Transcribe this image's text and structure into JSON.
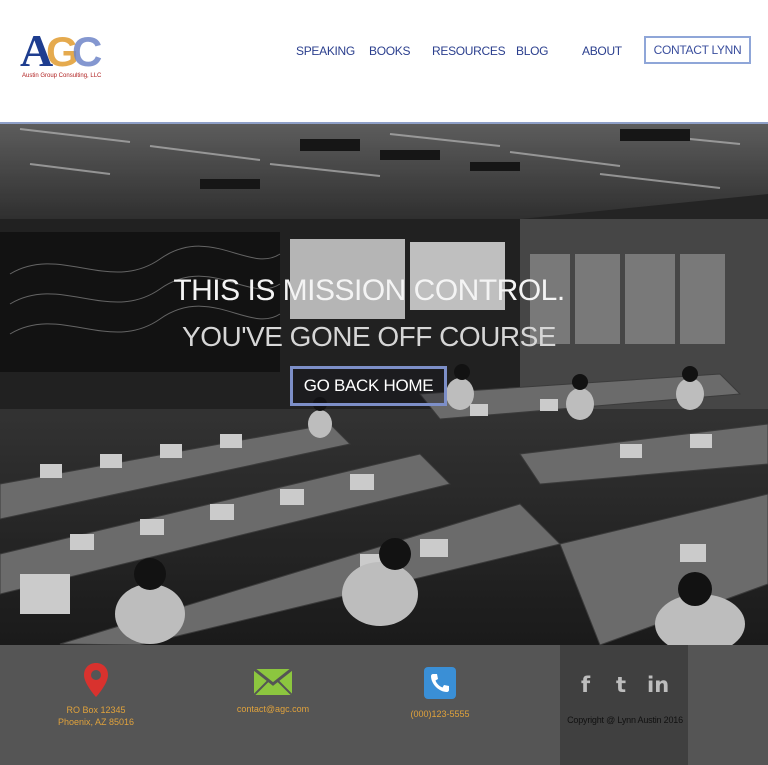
{
  "logo": {
    "text": "AGC",
    "tagline": "Austin Group Consulting, LLC"
  },
  "nav": {
    "items": [
      {
        "label": "SPEAKING"
      },
      {
        "label": "BOOKS"
      },
      {
        "label": "RESOURCES"
      },
      {
        "label": "BLOG"
      },
      {
        "label": "ABOUT"
      }
    ],
    "cta_label": "CONTACT LYNN"
  },
  "hero": {
    "title": "THIS IS MISSION CONTROL.",
    "subtitle": "YOU'VE GONE OFF COURSE",
    "button_label": "GO BACK HOME"
  },
  "footer": {
    "address_line1": "RO Box 12345",
    "address_line2": "Phoenix, AZ 85016",
    "email": "contact@agc.com",
    "phone": "(000)123-5555",
    "social": {
      "facebook": "f",
      "twitter": "t",
      "linkedin": "in"
    },
    "copyright": "Copyright @ Lynn Austin 2016"
  },
  "colors": {
    "nav_text": "#2b3f8e",
    "accent_border": "#7d8fc8",
    "footer_bg": "#555555",
    "footer_text": "#e0a23c",
    "pin_red": "#d9322e",
    "mail_green": "#8cc63f",
    "phone_blue": "#3a8fd6"
  }
}
